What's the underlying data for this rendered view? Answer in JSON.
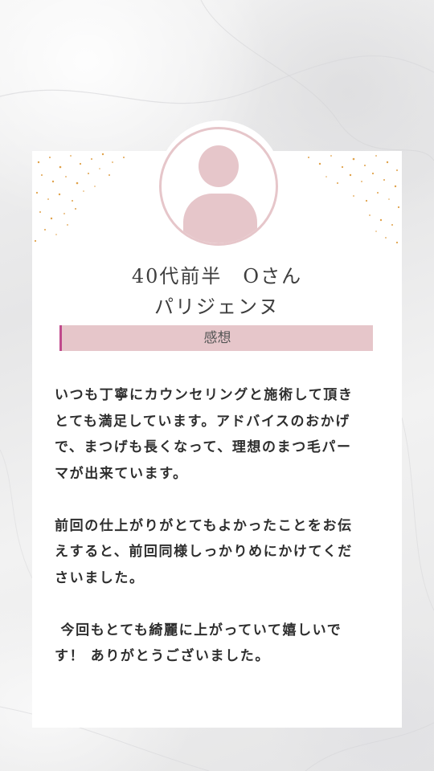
{
  "customer": {
    "name_line": "40代前半　Oさん",
    "service": "パリジェンヌ"
  },
  "section": {
    "label": "感想"
  },
  "review": {
    "text": "いつも丁寧にカウンセリングと施術して頂き\nとても満足しています。アドバイスのおかげ\nで、まつげも長くなって、理想のまつ毛パー\nマが出来ています。\n\n前回の仕上がりがとてもよかったことをお伝\nえすると、前回同様しっかりめにかけてくだ\nさいました。\n\n 今回もとても綺麗に上がっていて嬉しいで\nす！ ありがとうございました。"
  },
  "colors": {
    "accent_pink": "#e6c6ca",
    "bar_marker": "#c04a8c",
    "sparkle_gold": "#e0a24a"
  },
  "icons": {
    "avatar": "person-avatar-icon",
    "sparkles": "sparkles-decoration"
  }
}
